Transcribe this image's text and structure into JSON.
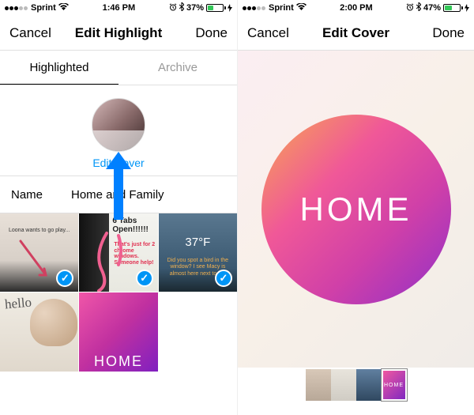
{
  "left": {
    "status": {
      "carrier": "Sprint",
      "time": "1:46 PM",
      "battery_pct": "37%",
      "battery_fill": 37
    },
    "nav": {
      "cancel": "Cancel",
      "title": "Edit Highlight",
      "done": "Done"
    },
    "tabs": {
      "highlighted": "Highlighted",
      "archive": "Archive"
    },
    "cover": {
      "edit_label": "Edit Cover"
    },
    "name": {
      "label": "Name",
      "value": "Home and Family"
    },
    "cells": {
      "c1_text": "Loona wants to go play...",
      "c2_title": "6 Tabs Open!!!!!!",
      "c2_sub": "That's just for 2 chrome windows. Someone help!",
      "c3_temp": "37°F",
      "c3_text": "Did you spot a bird in the window? I see Macy is almost here next to me",
      "c4_script": "hello",
      "c5_text": "HOME"
    }
  },
  "right": {
    "status": {
      "carrier": "Sprint",
      "time": "2:00 PM",
      "battery_pct": "47%",
      "battery_fill": 47
    },
    "nav": {
      "cancel": "Cancel",
      "title": "Edit Cover",
      "done": "Done"
    },
    "circle_text": "HOME",
    "thumb5": "HOME"
  }
}
